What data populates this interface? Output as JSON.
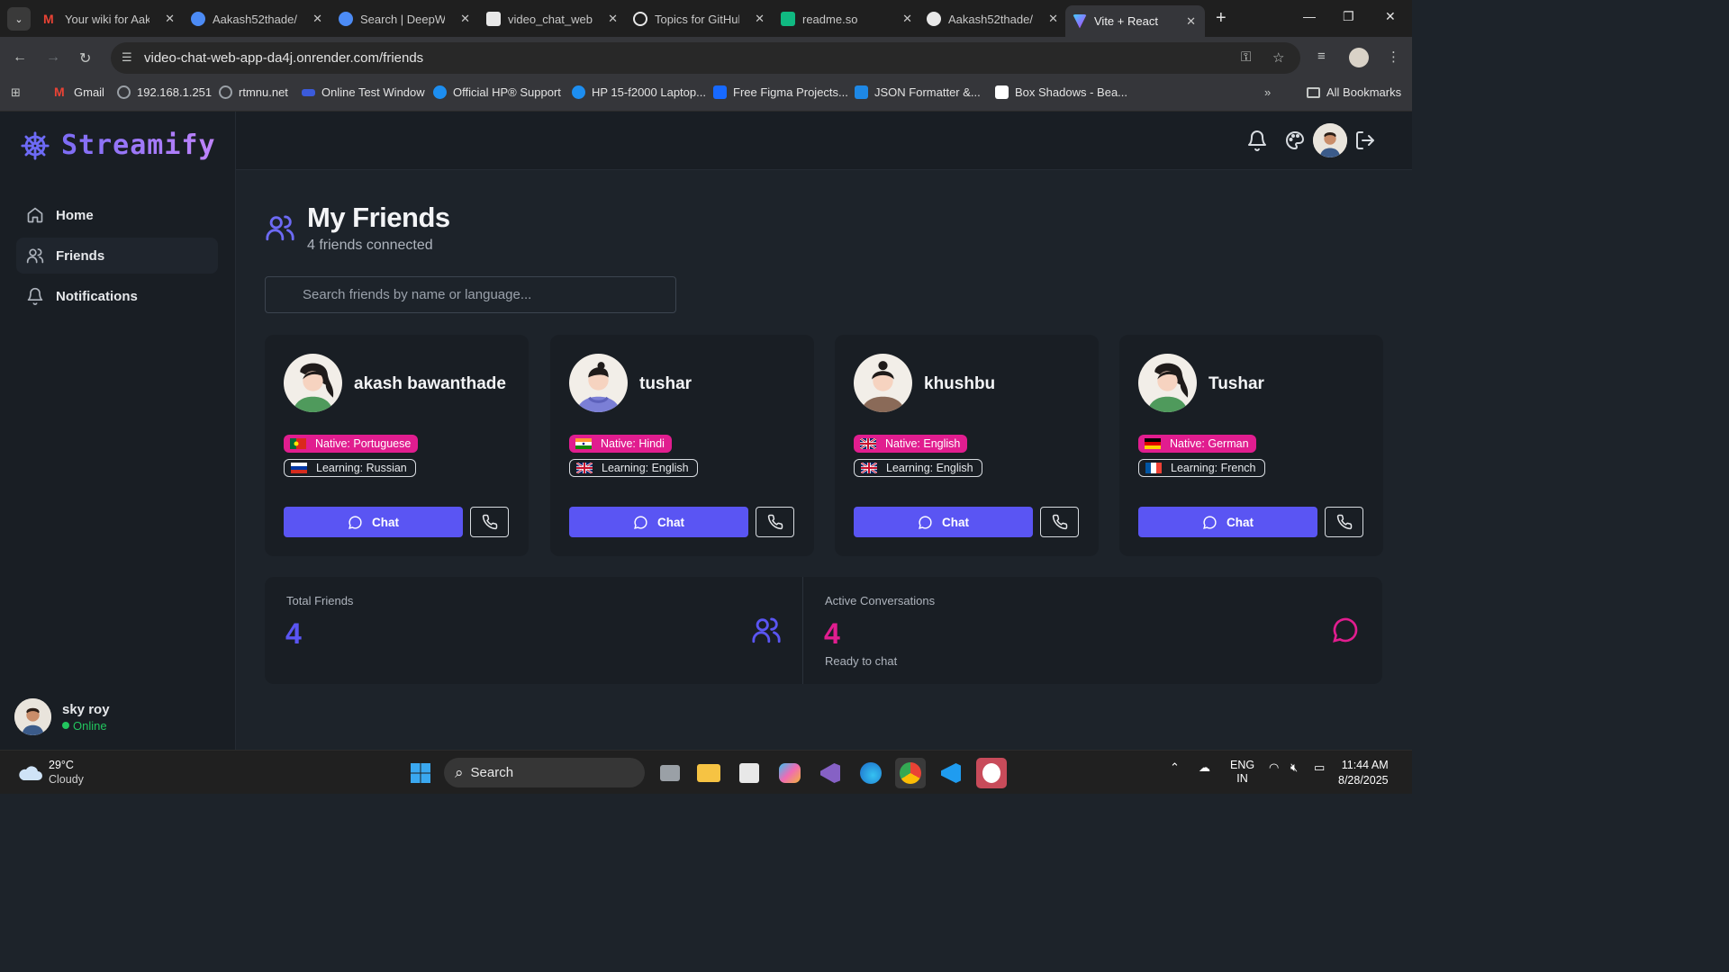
{
  "browser": {
    "tabs": [
      {
        "title": "Your wiki for Aak",
        "fav_color": "#ea4335"
      },
      {
        "title": "Aakash52thade/",
        "fav_color": "#4c8bf5"
      },
      {
        "title": "Search | DeepWi",
        "fav_color": "#4c8bf5"
      },
      {
        "title": "video_chat_web",
        "fav_color": "#e8e8e8"
      },
      {
        "title": "Topics for GitHul",
        "fav_color": "#e8e8e8"
      },
      {
        "title": "readme.so",
        "fav_color": "#10b981"
      },
      {
        "title": "Aakash52thade/",
        "fav_color": "#e8e8e8"
      },
      {
        "title": "Vite + React",
        "fav_color": "#a855f7"
      }
    ],
    "url": "video-chat-web-app-da4j.onrender.com/friends",
    "bookmarks": [
      {
        "label": "Gmail",
        "color": "#ea4335"
      },
      {
        "label": "192.168.1.251",
        "color": "#9aa0a6"
      },
      {
        "label": "rtmnu.net",
        "color": "#9aa0a6"
      },
      {
        "label": "Online Test Window",
        "color": "#3b5bdb"
      },
      {
        "label": "Official HP® Support",
        "color": "#1d8ef0"
      },
      {
        "label": "HP 15-f2000 Laptop...",
        "color": "#1d8ef0"
      },
      {
        "label": "Free Figma Projects...",
        "color": "#1769ff"
      },
      {
        "label": "JSON Formatter &...",
        "color": "#1e88e5"
      },
      {
        "label": "Box Shadows - Bea...",
        "color": "#ffffff"
      }
    ],
    "all_bookmarks": "All Bookmarks"
  },
  "app": {
    "brand": "Streamify",
    "nav": [
      {
        "label": "Home",
        "icon": "home-icon"
      },
      {
        "label": "Friends",
        "icon": "users-icon"
      },
      {
        "label": "Notifications",
        "icon": "bell-icon"
      }
    ],
    "user": {
      "name": "sky roy",
      "status": "Online"
    }
  },
  "page": {
    "title": "My Friends",
    "subtitle": "4 friends connected",
    "search_placeholder": "Search friends by name or language...",
    "friends": [
      {
        "name": "akash bawanthade",
        "native": "Native: Portuguese",
        "learning": "Learning: Russian",
        "native_flag": "PT",
        "learning_flag": "RU",
        "chat": "Chat"
      },
      {
        "name": "tushar",
        "native": "Native: Hindi",
        "learning": "Learning: English",
        "native_flag": "IN",
        "learning_flag": "GB",
        "chat": "Chat"
      },
      {
        "name": "khushbu",
        "native": "Native: English",
        "learning": "Learning: English",
        "native_flag": "GB",
        "learning_flag": "GB",
        "chat": "Chat"
      },
      {
        "name": "Tushar",
        "native": "Native: German",
        "learning": "Learning: French",
        "native_flag": "DE",
        "learning_flag": "FR",
        "chat": "Chat"
      }
    ],
    "stats": [
      {
        "label": "Total Friends",
        "value": "4",
        "color": "#5a55f3"
      },
      {
        "label": "Active Conversations",
        "value": "4",
        "desc": "Ready to chat",
        "color": "#e11d8f"
      }
    ]
  },
  "taskbar": {
    "temp": "29°C",
    "weather": "Cloudy",
    "search": "Search",
    "lang1": "ENG",
    "lang2": "IN",
    "time": "11:44 AM",
    "date": "8/28/2025"
  },
  "colors": {
    "accent": "#5a55f3",
    "pink": "#e11d8f",
    "bg": "#1d232a",
    "panel": "#191e24",
    "online": "#22c55e"
  }
}
